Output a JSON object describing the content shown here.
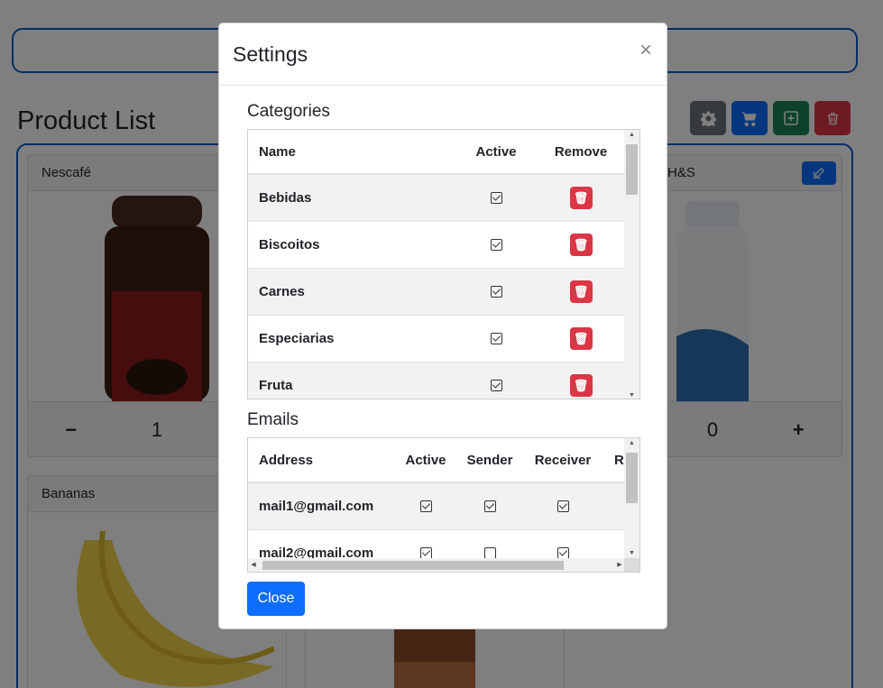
{
  "page": {
    "title": "Product List",
    "toolbar": {
      "settings_icon": "gear-icon",
      "cart_icon": "cart-icon",
      "add_icon": "plus-square-icon",
      "delete_icon": "trash-icon"
    },
    "products": [
      {
        "name": "Nescafé",
        "quantity": "1"
      },
      {
        "name": "H&S",
        "quantity": "0"
      },
      {
        "name": "Bananas"
      }
    ],
    "colors": {
      "primary": "#0d6efd",
      "danger": "#dc3545",
      "success": "#198754",
      "secondary": "#6c757d"
    }
  },
  "modal": {
    "title": "Settings",
    "close_symbol": "×",
    "categories": {
      "title": "Categories",
      "headers": [
        "Name",
        "Active",
        "Remove"
      ],
      "rows": [
        {
          "name": "Bebidas",
          "active": true
        },
        {
          "name": "Biscoitos",
          "active": true
        },
        {
          "name": "Carnes",
          "active": true
        },
        {
          "name": "Especiarias",
          "active": true
        },
        {
          "name": "Fruta",
          "active": true
        }
      ]
    },
    "emails": {
      "title": "Emails",
      "headers": [
        "Address",
        "Active",
        "Sender",
        "Receiver",
        "R"
      ],
      "rows": [
        {
          "address": "mail1@gmail.com",
          "active": true,
          "sender": true,
          "receiver": true
        },
        {
          "address": "mail2@gmail.com",
          "active": true,
          "sender": false,
          "receiver": true
        }
      ]
    },
    "close_label": "Close"
  }
}
